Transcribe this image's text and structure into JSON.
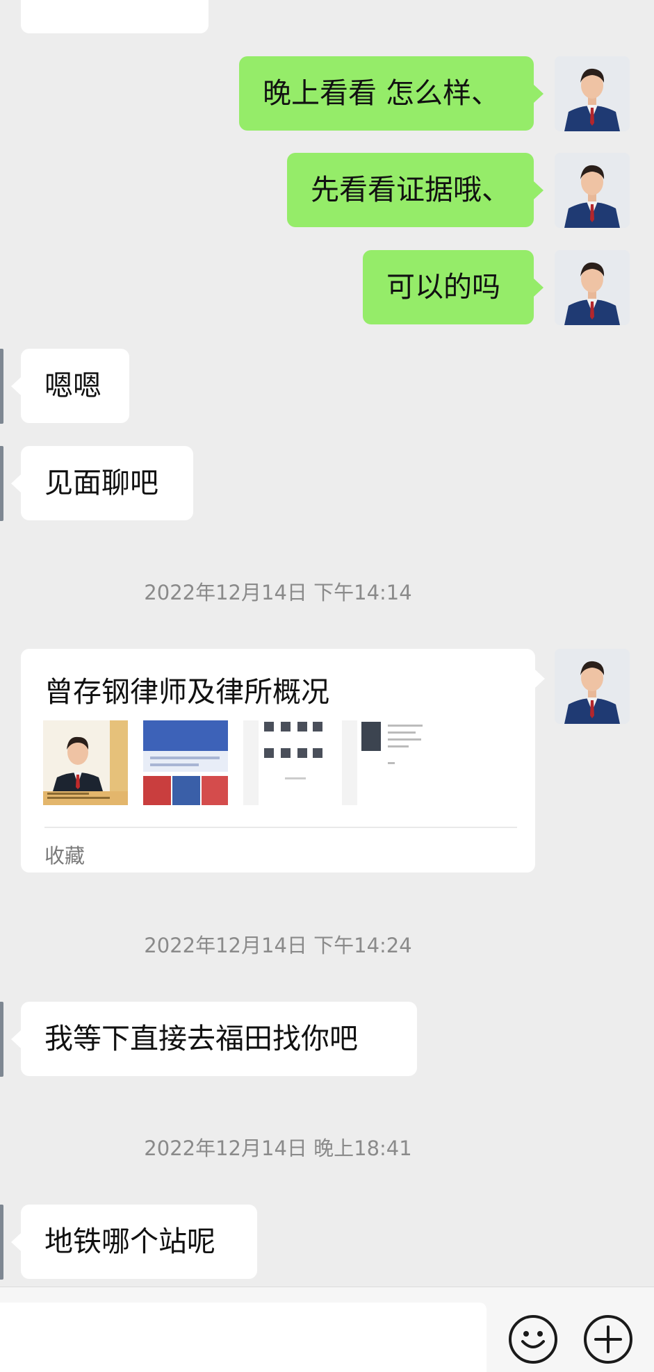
{
  "messages": [
    {
      "side": "me",
      "text": "晚上看看  怎么样、"
    },
    {
      "side": "me",
      "text": "先看看证据哦、"
    },
    {
      "side": "me",
      "text": "可以的吗"
    },
    {
      "side": "other",
      "text": "嗯嗯"
    },
    {
      "side": "other",
      "text": "见面聊吧"
    }
  ],
  "timestamps": [
    "2022年12月14日 下午14:14",
    "2022年12月14日 下午14:24",
    "2022年12月14日 晚上18:41"
  ],
  "favorite_card": {
    "title": "曾存钢律师及律所概况",
    "source": "收藏"
  },
  "later_messages": [
    {
      "side": "other",
      "text": "我等下直接去福田找你吧"
    },
    {
      "side": "other",
      "text": "地铁哪个站呢"
    }
  ],
  "icons": {
    "avatar": "avatar-man-in-suit",
    "emoji": "smiley-face-icon",
    "more": "plus-circle-icon"
  },
  "colors": {
    "background": "#ededed",
    "my_bubble": "#95ec69",
    "other_bubble": "#ffffff",
    "timestamp_text": "#8a8a8a"
  }
}
